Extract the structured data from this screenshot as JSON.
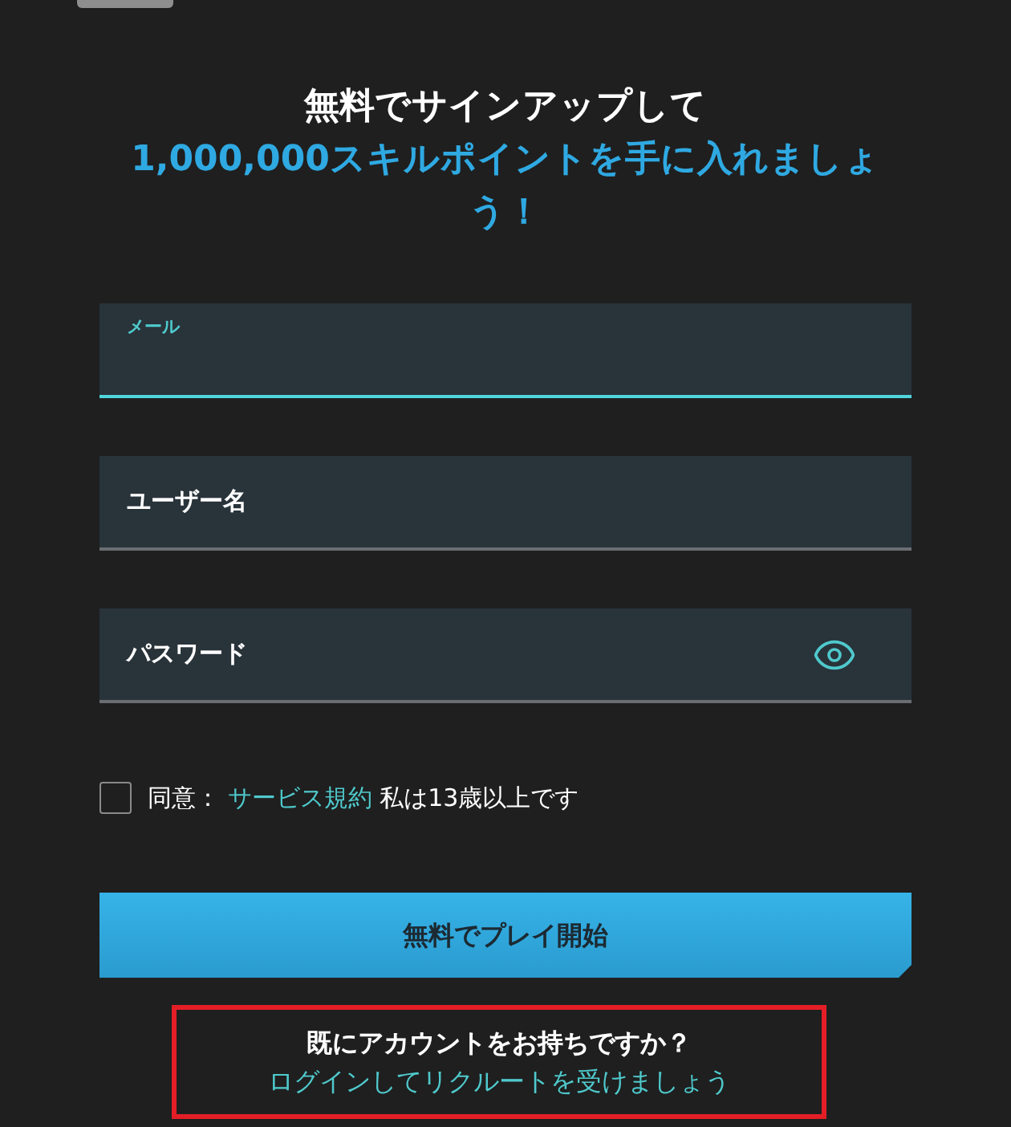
{
  "heading": {
    "title": "無料でサインアップして",
    "highlight": "1,000,000スキルポイントを手に入れましょう！"
  },
  "fields": [
    {
      "label": "メール",
      "kind": "text",
      "focused": true
    },
    {
      "label": "ユーザー名",
      "kind": "text",
      "focused": false
    },
    {
      "label": "パスワード",
      "kind": "password",
      "focused": false
    }
  ],
  "consent": {
    "checked": false,
    "prefix": "同意：",
    "link": "サービス規約",
    "suffix": "私は13歳以上です"
  },
  "submit": {
    "label": "無料でプレイ開始"
  },
  "login_prompt": {
    "question": "既にアカウントをお持ちですか？",
    "link": "ログインしてリクルートを受けましょう",
    "highlighted": true
  }
}
